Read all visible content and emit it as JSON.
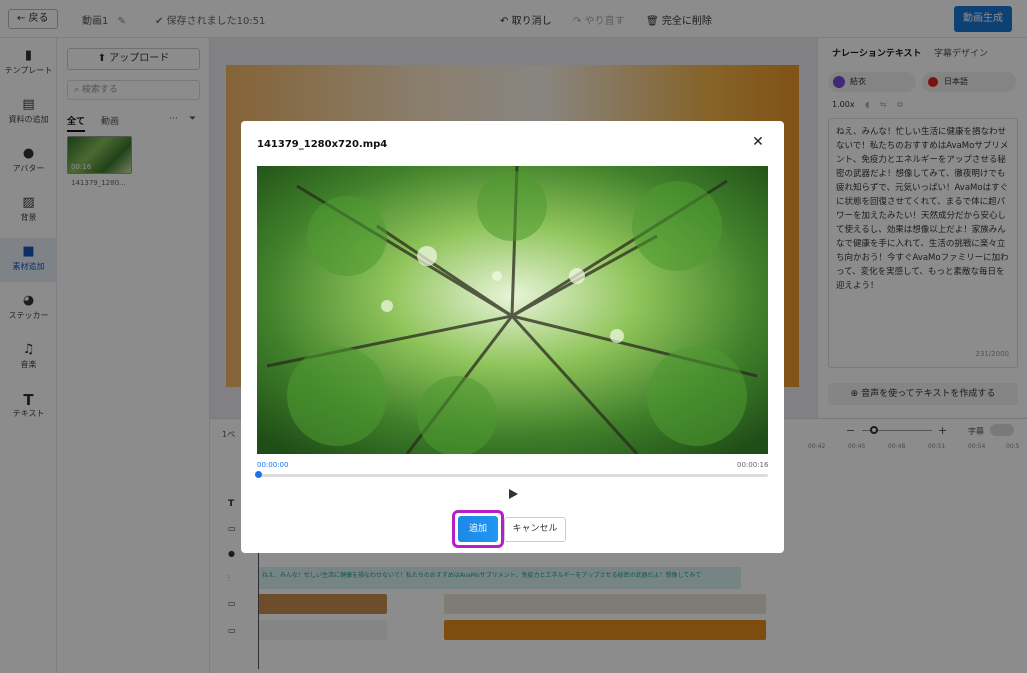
{
  "header": {
    "back_label": "← 戻る",
    "video_name": "動画1",
    "saved_status": "保存されました10:51",
    "undo_label": "取り消し",
    "redo_label": "やり直す",
    "delete_all_label": "完全に削除",
    "generate_label": "動画生成"
  },
  "sidebar": {
    "items": [
      {
        "label": "テンプレート"
      },
      {
        "label": "資料の追加"
      },
      {
        "label": "アバター"
      },
      {
        "label": "背景"
      },
      {
        "label": "素材追加"
      },
      {
        "label": "ステッカー"
      },
      {
        "label": "音楽"
      },
      {
        "label": "テキスト"
      }
    ]
  },
  "assets": {
    "upload_label": "アップロード",
    "search_placeholder": "検索する",
    "tab_all": "全て",
    "tab_video": "動画",
    "items": [
      {
        "duration": "00:16",
        "name": "141379_1280..."
      }
    ]
  },
  "right_panel": {
    "tab_narration": "ナレーションテキスト",
    "tab_caption": "字幕デザイン",
    "voice_name": "結衣",
    "language": "日本語",
    "speed": "1.00x",
    "narration_text": "ねえ、みんな！忙しい生活に健康を損なわせないで！私たちのおすすめはAvaMoサプリメント、免疫力とエネルギーをアップさせる秘密の武器だよ！想像してみて、徹夜明けでも疲れ知らずで、元気いっぱい！AvaMoはすぐに状態を回復させてくれて、まるで体に超パワーを加えたみたい！天然成分だから安心して使えるし、効果は想像以上だよ！家族みんなで健康を手に入れて、生活の挑戦に楽々立ち向かおう！今すぐAvaMoファミリーに加わって、変化を実感して、もっと素敵な毎日を迎えよう！",
    "char_count": "231/2000",
    "voice_create_label": "音声を使ってテキストを作成する"
  },
  "timeline": {
    "page_label": "1ペ",
    "caption_label": "字幕",
    "track_text": "ねえ、みんな！忙しい生活に健康を損なわせないで！私たちのおすすめはAvaMoサプリメント、免疫力とエネルギーをアップさせる秘密の武器だよ！想像してみて",
    "ticks": [
      "00:42",
      "00:45",
      "00:48",
      "00:51",
      "00:54",
      "00:5"
    ]
  },
  "modal": {
    "title": "141379_1280x720.mp4",
    "time_current": "00:00:00",
    "time_total": "00:00:16",
    "add_label": "追加",
    "cancel_label": "キャンセル"
  },
  "colors": {
    "primary": "#1976d2",
    "highlight": "#b71ec9",
    "active_nav": "#1a56b8"
  }
}
